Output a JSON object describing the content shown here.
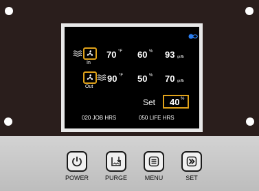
{
  "status": {
    "icon": "eco-link-icon",
    "color": "#2a7df0"
  },
  "intake": {
    "label": "In",
    "temp": "70",
    "temp_unit": "°F",
    "humidity": "60",
    "humidity_unit": "%",
    "grains": "93",
    "grains_unit": "gr/lb"
  },
  "outlet": {
    "label": "Out",
    "temp": "90",
    "temp_unit": "°F",
    "humidity": "50",
    "humidity_unit": "%",
    "grains": "70",
    "grains_unit": "gr/lb"
  },
  "setpoint": {
    "label": "Set",
    "value": "40",
    "unit": "%"
  },
  "hours": {
    "job": "020 JOB HRS",
    "life": "050 LIFE HRS"
  },
  "buttons": [
    {
      "label": "POWER",
      "icon": "power-icon"
    },
    {
      "label": "PURGE",
      "icon": "purge-icon"
    },
    {
      "label": "MENU",
      "icon": "menu-icon"
    },
    {
      "label": "SET",
      "icon": "fast-forward-icon"
    }
  ],
  "colors": {
    "accent": "#e0a21a",
    "bezel": "#2a1e1c",
    "panel": "#c9c9c9"
  }
}
